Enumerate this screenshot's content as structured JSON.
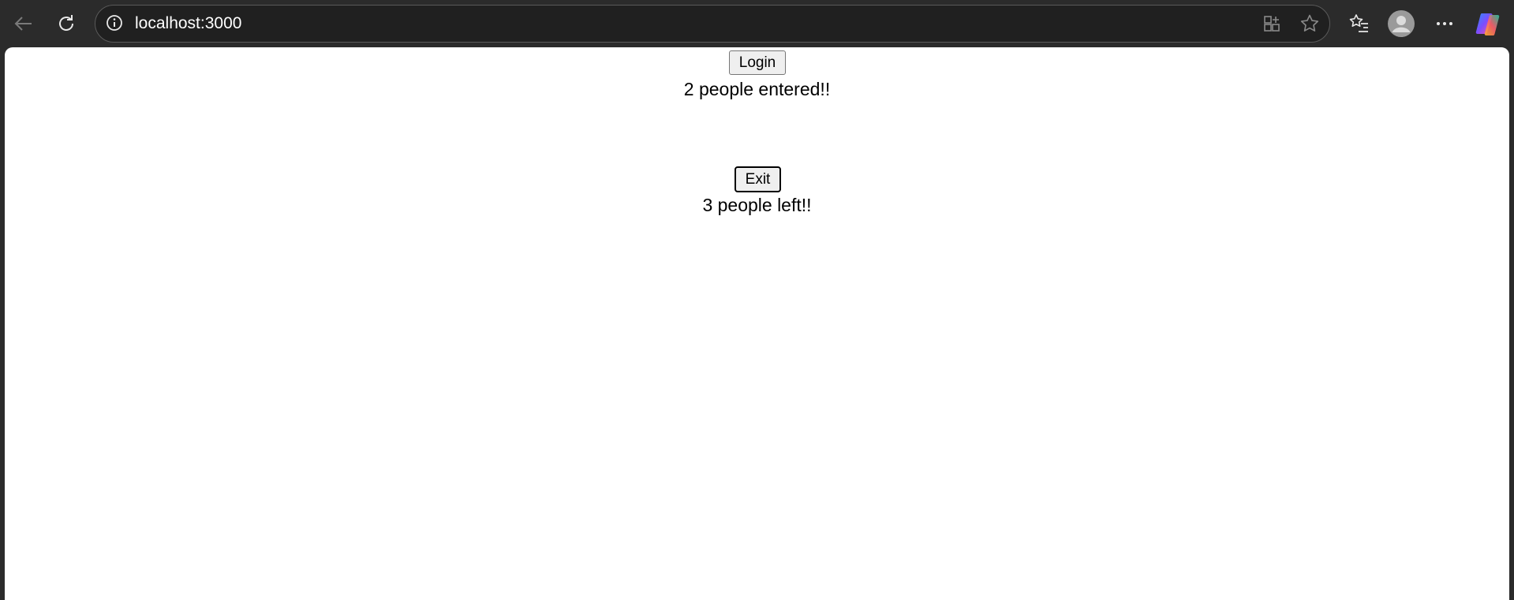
{
  "browser": {
    "url": "localhost:3000",
    "icons": [
      "back-icon",
      "refresh-icon",
      "site-info-icon",
      "app-available-icon",
      "favorite-star-icon",
      "favorites-list-icon",
      "profile-avatar-icon",
      "more-menu-icon",
      "copilot-icon"
    ]
  },
  "page": {
    "login_label": "Login",
    "entered_text": "2 people entered!!",
    "exit_label": "Exit",
    "left_text": "3 people left!!"
  },
  "colors": {
    "toolbar_bg": "#2b2b2b",
    "page_bg": "#ffffff",
    "button_bg": "#efefef"
  }
}
